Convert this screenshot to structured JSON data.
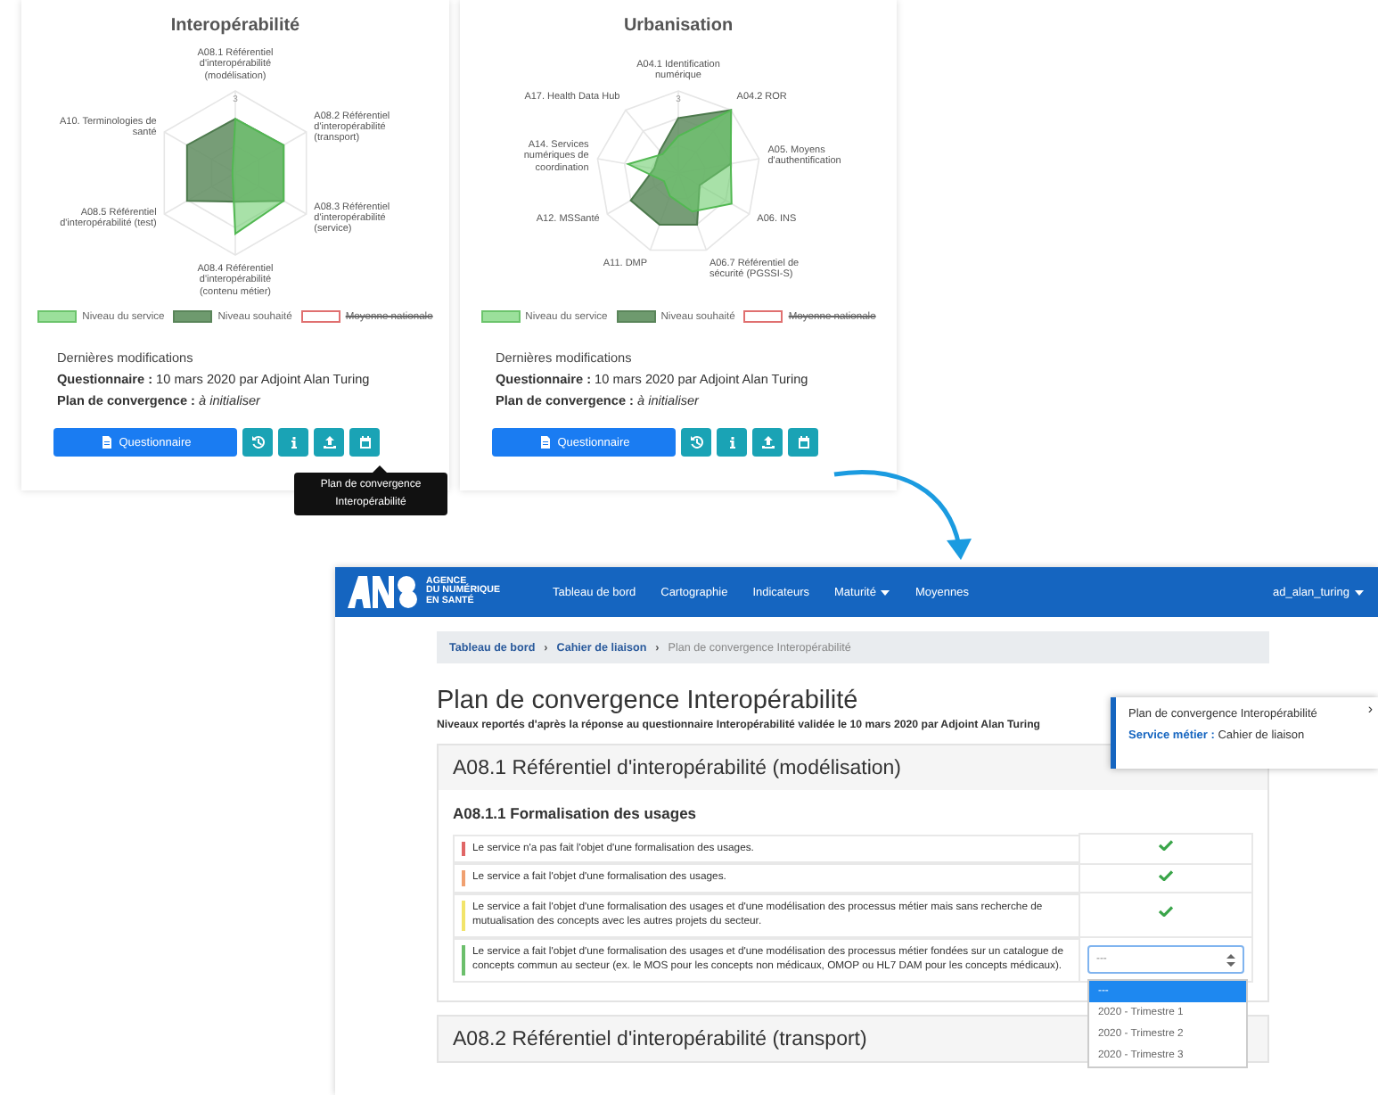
{
  "cards": [
    {
      "title": "Interopérabilité",
      "chart": {
        "scale_label": "3",
        "axes": [
          "A08.1 Référentiel d'interopérabilité (modélisation)",
          "A10. Terminologies de santé",
          "A08.2 Référentiel d'interopérabilité (transport)",
          "A08.5 Référentiel d'interopérabilité (test)",
          "A08.3 Référentiel d'interopérabilité (service)",
          "A08.4 Référentiel d'interopérabilité (contenu métier)"
        ]
      },
      "legend": [
        {
          "label": "Niveau du service",
          "kind": "service",
          "hidden": false
        },
        {
          "label": "Niveau souhaité",
          "kind": "target",
          "hidden": false
        },
        {
          "label": "Moyenne nationale",
          "kind": "average",
          "hidden": true
        }
      ],
      "history_title": "Dernières modifications",
      "history": [
        "**Questionnaire :** 10 mars 2020 par Adjoint Alan Turing",
        "**Plan de convergence :** *à initialiser*"
      ],
      "button": "Questionnaire",
      "actions": [
        {
          "kind": "history"
        },
        {
          "kind": "info"
        },
        {
          "kind": "upload"
        },
        {
          "kind": "calendar"
        }
      ]
    },
    {
      "title": "Urbanisation",
      "chart": {
        "scale_label": "3",
        "axes": [
          "A04.1 Identification numérique",
          "A17. Health Data Hub",
          "A04.2 ROR",
          "A14. Services numériques de coordination",
          "A05. Moyens d'authentification",
          "A12. MSSanté",
          "A06. INS",
          "A11. DMP",
          "A06.7 Référentiel de sécurité (PGSSI-S)"
        ]
      },
      "legend": [
        {
          "label": "Niveau du service",
          "kind": "service",
          "hidden": false
        },
        {
          "label": "Niveau souhaité",
          "kind": "target",
          "hidden": false
        },
        {
          "label": "Moyenne nationale",
          "kind": "average",
          "hidden": true
        }
      ],
      "history_title": "Dernières modifications",
      "history": [
        "**Questionnaire :** 10 mars 2020 par Adjoint Alan Turing",
        "**Plan de convergence :** *à initialiser*"
      ],
      "button": "Questionnaire",
      "actions": [
        {
          "kind": "history"
        },
        {
          "kind": "info"
        },
        {
          "kind": "upload"
        },
        {
          "kind": "calendar"
        }
      ]
    }
  ],
  "tooltip": "Plan de convergence Interopérabilité",
  "app": {
    "brand": [
      "AGENCE",
      "DU NUMÉRIQUE",
      "EN SANTÉ"
    ],
    "nav": [
      {
        "label": "Tableau de bord",
        "dropdown": false
      },
      {
        "label": "Cartographie",
        "dropdown": false
      },
      {
        "label": "Indicateurs",
        "dropdown": false
      },
      {
        "label": "Maturité",
        "dropdown": true
      },
      {
        "label": "Moyennes",
        "dropdown": false
      }
    ],
    "user": "ad_alan_turing",
    "breadcrumb_separators": [
      "›",
      "›"
    ],
    "breadcrumb": [
      {
        "label": "Tableau de bord",
        "current": false
      },
      {
        "label": "Cahier de liaison",
        "current": false
      },
      {
        "label": "Plan de convergence Interopérabilité",
        "current": true
      }
    ],
    "title": "Plan de convergence Interopérabilité",
    "subtitle": "Niveaux reportés d'après la réponse au questionnaire Interopérabilité validée le 10 mars 2020 par Adjoint Alan Turing",
    "popover": {
      "title": "Plan de convergence Interopérabilité",
      "text": "**Service métier :** Cahier de liaison",
      "close": "›"
    },
    "sections": [
      {
        "title": "A08.1 Référentiel d'interopérabilité (modélisation)",
        "subsections": [
          {
            "title": "A08.1.1 Formalisation des usages",
            "rows": [
              {
                "text": "Le service n'a pas fait l'objet d'une formalisation des usages.",
                "color": "#e06666",
                "kind": "check"
              },
              {
                "text": "Le service a fait l'objet d'une formalisation des usages.",
                "color": "#f0a070",
                "kind": "check"
              },
              {
                "text": "Le service a fait l'objet d'une formalisation des usages et d'une modélisation des processus métier mais sans recherche de mutualisation des concepts avec les autres projets du secteur.",
                "color": "#f2e46a",
                "kind": "check"
              },
              {
                "text": "Le service a fait l'objet d'une formalisation des usages et d'une modélisation des processus métier fondées sur un catalogue de concepts commun au secteur (ex. le MOS pour les concepts non médicaux, OMOP ou HL7 DAM pour les concepts médicaux).",
                "color": "#6cbf6c",
                "kind": "select",
                "select": {
                  "value": "---",
                  "open": true,
                  "options": [
                    {
                      "label": "---",
                      "selected": true
                    },
                    {
                      "label": "2020 - Trimestre 1",
                      "selected": false
                    },
                    {
                      "label": "2020 - Trimestre 2",
                      "selected": false
                    },
                    {
                      "label": "2020 - Trimestre 3",
                      "selected": false
                    }
                  ]
                }
              }
            ]
          }
        ]
      },
      {
        "title": "A08.2 Référentiel d'interopérabilité (transport)"
      }
    ]
  }
}
